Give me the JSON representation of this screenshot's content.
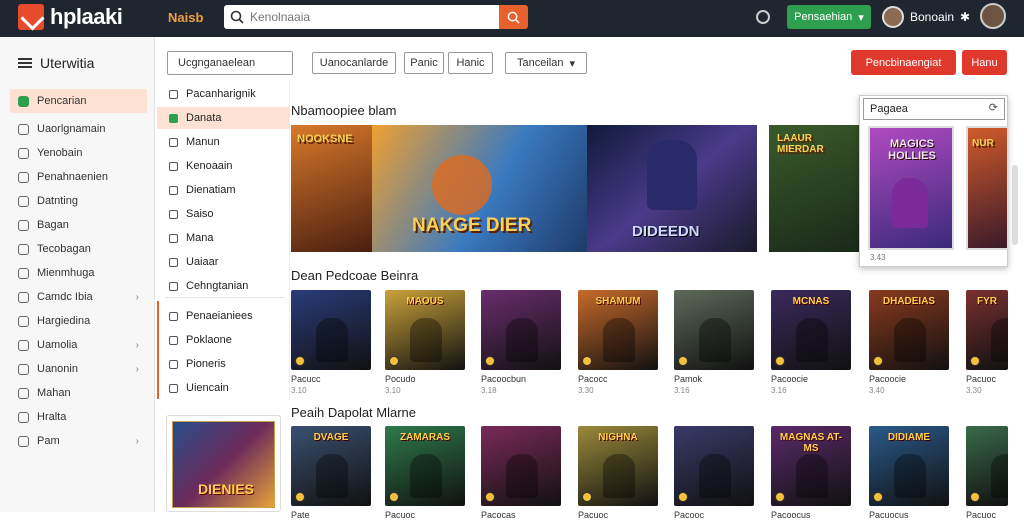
{
  "header": {
    "logo_text": "hplaaki",
    "link": "Naisb",
    "search_placeholder": "Kenolnaaia",
    "dropdown_label": "Pensaehian",
    "user_name": "Bonoain"
  },
  "sidebar": {
    "title": "Uterwitia",
    "items": [
      {
        "label": "Pencarian",
        "chevron": ""
      },
      {
        "label": "Uaorlgnamain",
        "chevron": ""
      },
      {
        "label": "Yenobain",
        "chevron": ""
      },
      {
        "label": "Penahnaenien",
        "chevron": ""
      },
      {
        "label": "Datnting",
        "chevron": ""
      },
      {
        "label": "Bagan",
        "chevron": ""
      },
      {
        "label": "Tecobagan",
        "chevron": ""
      },
      {
        "label": "Mienmhuga",
        "chevron": ""
      },
      {
        "label": "Camdc Ibia",
        "chevron": "›"
      },
      {
        "label": "Hargiedina",
        "chevron": ""
      },
      {
        "label": "Uamolia",
        "chevron": "›"
      },
      {
        "label": "Uanonin",
        "chevron": "›"
      },
      {
        "label": "Mahan",
        "chevron": ""
      },
      {
        "label": "Hralta",
        "chevron": ""
      },
      {
        "label": "Pam",
        "chevron": "›"
      }
    ]
  },
  "toolbar": {
    "dropdown1": "Ucgnganaelean",
    "btn1": "Uanocanlarde",
    "btn2": "Panic",
    "btn3": "Hanic",
    "dropdown2": "Tanceilan",
    "red1": "Pencbinaengiat",
    "red2": "Hanu"
  },
  "menu": {
    "items": [
      "Pacanharignik",
      "Danata",
      "Manun",
      "Kenoaain",
      "Dienatiam",
      "Saiso",
      "Mana",
      "Uaiaar",
      "Cehngtanian",
      "Penaeianiees",
      "Poklaone",
      "Pioneris",
      "Uiencain"
    ]
  },
  "promo": {
    "title": "DIENIES"
  },
  "sections": {
    "s1": "Nbamoopiee blam",
    "s2": "Dean Pedcoae Beinra",
    "s3": "Peaih Dapolat Mlarne"
  },
  "banners": {
    "b1": "NOOKSNE",
    "b2": "NAKGE DIER",
    "b3": "DIDEEDN",
    "b4": "LAAUR MIERDAR"
  },
  "dropdown_panel": {
    "input": "Pagaea",
    "card_title": "MAGICS HOLLIES",
    "card2_title": "NUR",
    "meta": "3.43"
  },
  "row1": [
    {
      "title": "Pacucc",
      "sub": "3.10",
      "tag": "",
      "bg": "#2a3c7a"
    },
    {
      "title": "Pocudo",
      "sub": "3.10",
      "tag": "MAOUS",
      "bg": "#c9a23a"
    },
    {
      "title": "Pacoocbun",
      "sub": "3.18",
      "tag": "",
      "bg": "#6a2d6e"
    },
    {
      "title": "Pacocc",
      "sub": "3.30",
      "tag": "SHAMUM",
      "bg": "#c86a2a"
    },
    {
      "title": "Pamok",
      "sub": "3.16",
      "tag": "",
      "bg": "#5d6a5a"
    },
    {
      "title": "Pacoocie",
      "sub": "3.16",
      "tag": "MCNAS",
      "bg": "#3a2a5e"
    },
    {
      "title": "Pacoocie",
      "sub": "3.40",
      "tag": "DHADEIAS",
      "bg": "#8a3a1e"
    },
    {
      "title": "Pacuoc",
      "sub": "3.30",
      "tag": "FYR",
      "bg": "#7a3030"
    }
  ],
  "row2": [
    {
      "title": "Pate",
      "sub": "",
      "tag": "DVAGE",
      "bg": "#3a5070"
    },
    {
      "title": "Pacuoc",
      "sub": "",
      "tag": "ZAMARAS",
      "bg": "#2e7a4a"
    },
    {
      "title": "Pacocas",
      "sub": "",
      "tag": "",
      "bg": "#7a2a5a"
    },
    {
      "title": "Pacuoc",
      "sub": "",
      "tag": "NIGHNA",
      "bg": "#9a8a3a"
    },
    {
      "title": "Pacooc",
      "sub": "",
      "tag": "",
      "bg": "#3a3a6a"
    },
    {
      "title": "Pacoocus",
      "sub": "",
      "tag": "MAGNAS AT-MS",
      "bg": "#5a2a6a"
    },
    {
      "title": "Pacuocus",
      "sub": "",
      "tag": "DIDIAME",
      "bg": "#2a5a8a"
    },
    {
      "title": "Pacuoc",
      "sub": "",
      "tag": "",
      "bg": "#3a6a4a"
    }
  ]
}
